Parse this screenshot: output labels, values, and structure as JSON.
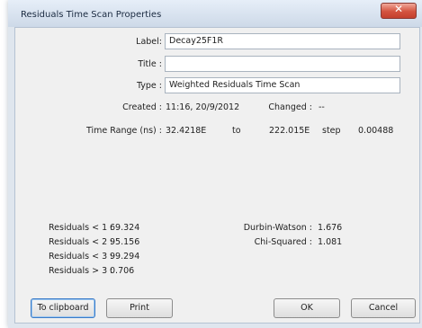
{
  "window": {
    "title": "Residuals Time Scan Properties",
    "close_glyph": "✕"
  },
  "props": {
    "label_caption": "Label:",
    "label_value": "Decay25F1R",
    "title_caption": "Title :",
    "title_value": "",
    "type_caption": "Type :",
    "type_value": "Weighted Residuals Time Scan",
    "created_caption": "Created :",
    "created_value": "11:16, 20/9/2012",
    "changed_caption": "Changed :",
    "changed_value": "--",
    "time_range_caption": "Time Range (ns) :",
    "time_from": "32.4218E",
    "to_caption": "to",
    "time_to": "222.015E",
    "step_caption": "step",
    "step_value": "0.00488"
  },
  "stats": {
    "residuals": [
      {
        "label": "Residuals < 1 :",
        "value": "69.324"
      },
      {
        "label": "Residuals < 2 :",
        "value": "95.156"
      },
      {
        "label": "Residuals < 3 :",
        "value": "99.294"
      },
      {
        "label": "Residuals > 3 :",
        "value": "0.706"
      }
    ],
    "durbin_watson_caption": "Durbin-Watson :",
    "durbin_watson_value": "1.676",
    "chi_squared_caption": "Chi-Squared :",
    "chi_squared_value": "1.081"
  },
  "buttons": {
    "clipboard": "To clipboard",
    "print": "Print",
    "ok": "OK",
    "cancel": "Cancel"
  }
}
